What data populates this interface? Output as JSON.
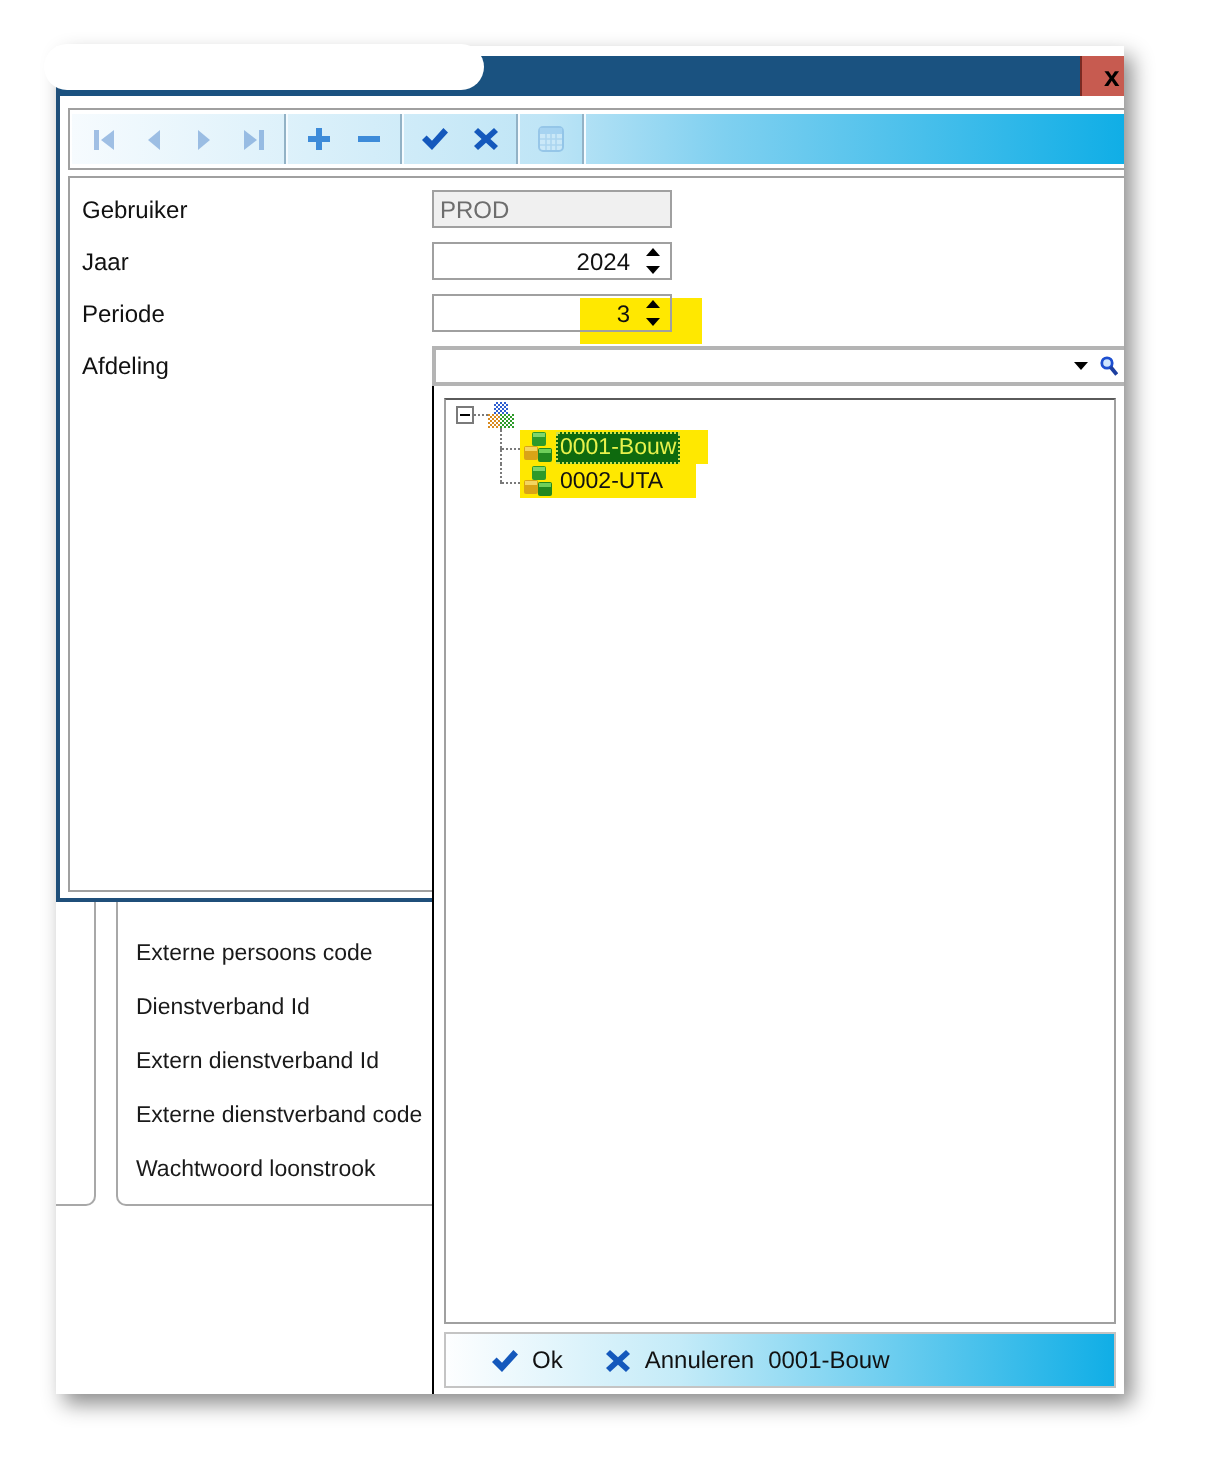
{
  "window": {
    "close_label": "x"
  },
  "toolbar": {
    "groups": [
      [
        {
          "kind": "first",
          "disabled": true
        },
        {
          "kind": "previous",
          "disabled": true
        },
        {
          "kind": "next",
          "disabled": true
        },
        {
          "kind": "last",
          "disabled": true
        }
      ],
      [
        {
          "kind": "add",
          "disabled": false
        },
        {
          "kind": "remove",
          "disabled": false
        }
      ],
      [
        {
          "kind": "confirm",
          "disabled": false
        },
        {
          "kind": "cancel",
          "disabled": false
        }
      ],
      [
        {
          "kind": "grid",
          "disabled": true
        }
      ]
    ]
  },
  "form": {
    "fields": [
      {
        "kind": "text",
        "label": "Gebruiker",
        "value": "PROD",
        "disabled": true,
        "highlighted": false
      },
      {
        "kind": "spin",
        "label": "Jaar",
        "value": "2024",
        "disabled": false,
        "highlighted": false
      },
      {
        "kind": "spin",
        "label": "Periode",
        "value": "3",
        "disabled": false,
        "highlighted": true
      },
      {
        "kind": "dropdown",
        "label": "Afdeling",
        "disabled": false,
        "highlighted": false,
        "expanded": true
      }
    ]
  },
  "dropdown_popup": {
    "tree": {
      "expanded": true,
      "children": [
        {
          "label": "0001-Bouw",
          "selected": true,
          "highlighted": true
        },
        {
          "label": "0002-UTA",
          "selected": false,
          "highlighted": true
        }
      ]
    },
    "buttons": [
      {
        "kind": "ok",
        "label": "Ok"
      },
      {
        "kind": "cancel",
        "label": "Annuleren"
      }
    ],
    "current_value": "0001-Bouw"
  },
  "background_form": {
    "labels": [
      "Externe persoons code",
      "Dienstverband Id",
      "Extern dienstverband Id",
      "Externe dienstverband code",
      "Wachtwoord loonstrook"
    ]
  }
}
